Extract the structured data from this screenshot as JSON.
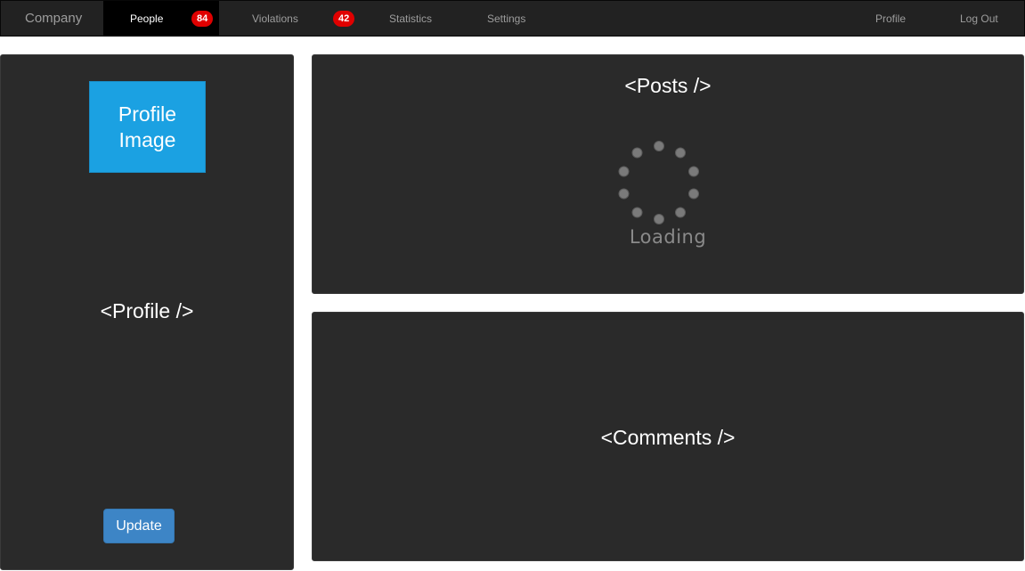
{
  "navbar": {
    "brand": "Company",
    "items": [
      {
        "label": "People",
        "badge": "84",
        "active": true
      },
      {
        "label": "Violations",
        "badge": "42",
        "active": false
      },
      {
        "label": "Statistics",
        "active": false
      },
      {
        "label": "Settings",
        "active": false
      }
    ],
    "right_items": [
      {
        "label": "Profile"
      },
      {
        "label": "Log Out"
      }
    ],
    "colors": {
      "background": "#222222",
      "active": "#000000",
      "badge": "#e00000",
      "text": "#9d9d9d"
    }
  },
  "profile_panel": {
    "image_label": "Profile Image",
    "heading": "<Profile />",
    "update_label": "Update",
    "colors": {
      "image": "#1ba1e2",
      "button": "#3d85c6"
    }
  },
  "posts_panel": {
    "heading": "<Posts />",
    "loading_text": "Loading",
    "spinner_icon": "loading-spinner-icon"
  },
  "comments_panel": {
    "heading": "<Comments />"
  },
  "theme": {
    "panel_background": "#2a2a2a",
    "page_background": "#ffffff"
  }
}
